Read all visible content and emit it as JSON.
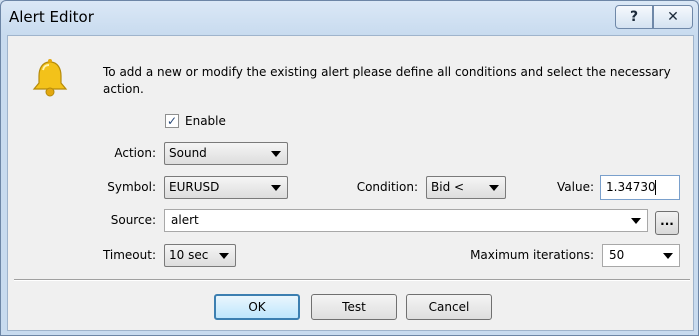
{
  "window": {
    "title": "Alert Editor",
    "help_label": "?",
    "close_label": "✕"
  },
  "intro": "To add a new or modify the existing alert please define all conditions and select the necessary action.",
  "enable": {
    "label": "Enable",
    "checked": true,
    "mark": "✓"
  },
  "action": {
    "label": "Action:",
    "value": "Sound"
  },
  "symbol": {
    "label": "Symbol:",
    "value": "EURUSD"
  },
  "condition": {
    "label": "Condition:",
    "value": "Bid <"
  },
  "value": {
    "label": "Value:",
    "value": "1.34730"
  },
  "source": {
    "label": "Source:",
    "value": "alert",
    "browse_label": "..."
  },
  "timeout": {
    "label": "Timeout:",
    "value": "10 sec"
  },
  "max_iterations": {
    "label": "Maximum iterations:",
    "value": "50"
  },
  "buttons": {
    "ok": "OK",
    "test": "Test",
    "cancel": "Cancel"
  },
  "colors": {
    "accent": "#3c7fb1",
    "bell": "#f3c21a"
  }
}
